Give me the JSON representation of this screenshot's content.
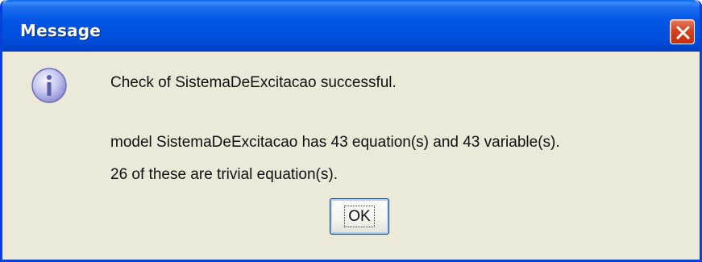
{
  "window": {
    "title": "Message"
  },
  "dialog": {
    "icon": "info-icon",
    "line1": "Check of SistemaDeExcitacao successful.",
    "line2": "model SistemaDeExcitacao has 43 equation(s) and 43 variable(s).",
    "line3": "26 of these are trivial equation(s).",
    "ok_label": "OK"
  },
  "colors": {
    "titlebar": "#0055e4",
    "close_button": "#d4431f",
    "background": "#ece9d8"
  }
}
